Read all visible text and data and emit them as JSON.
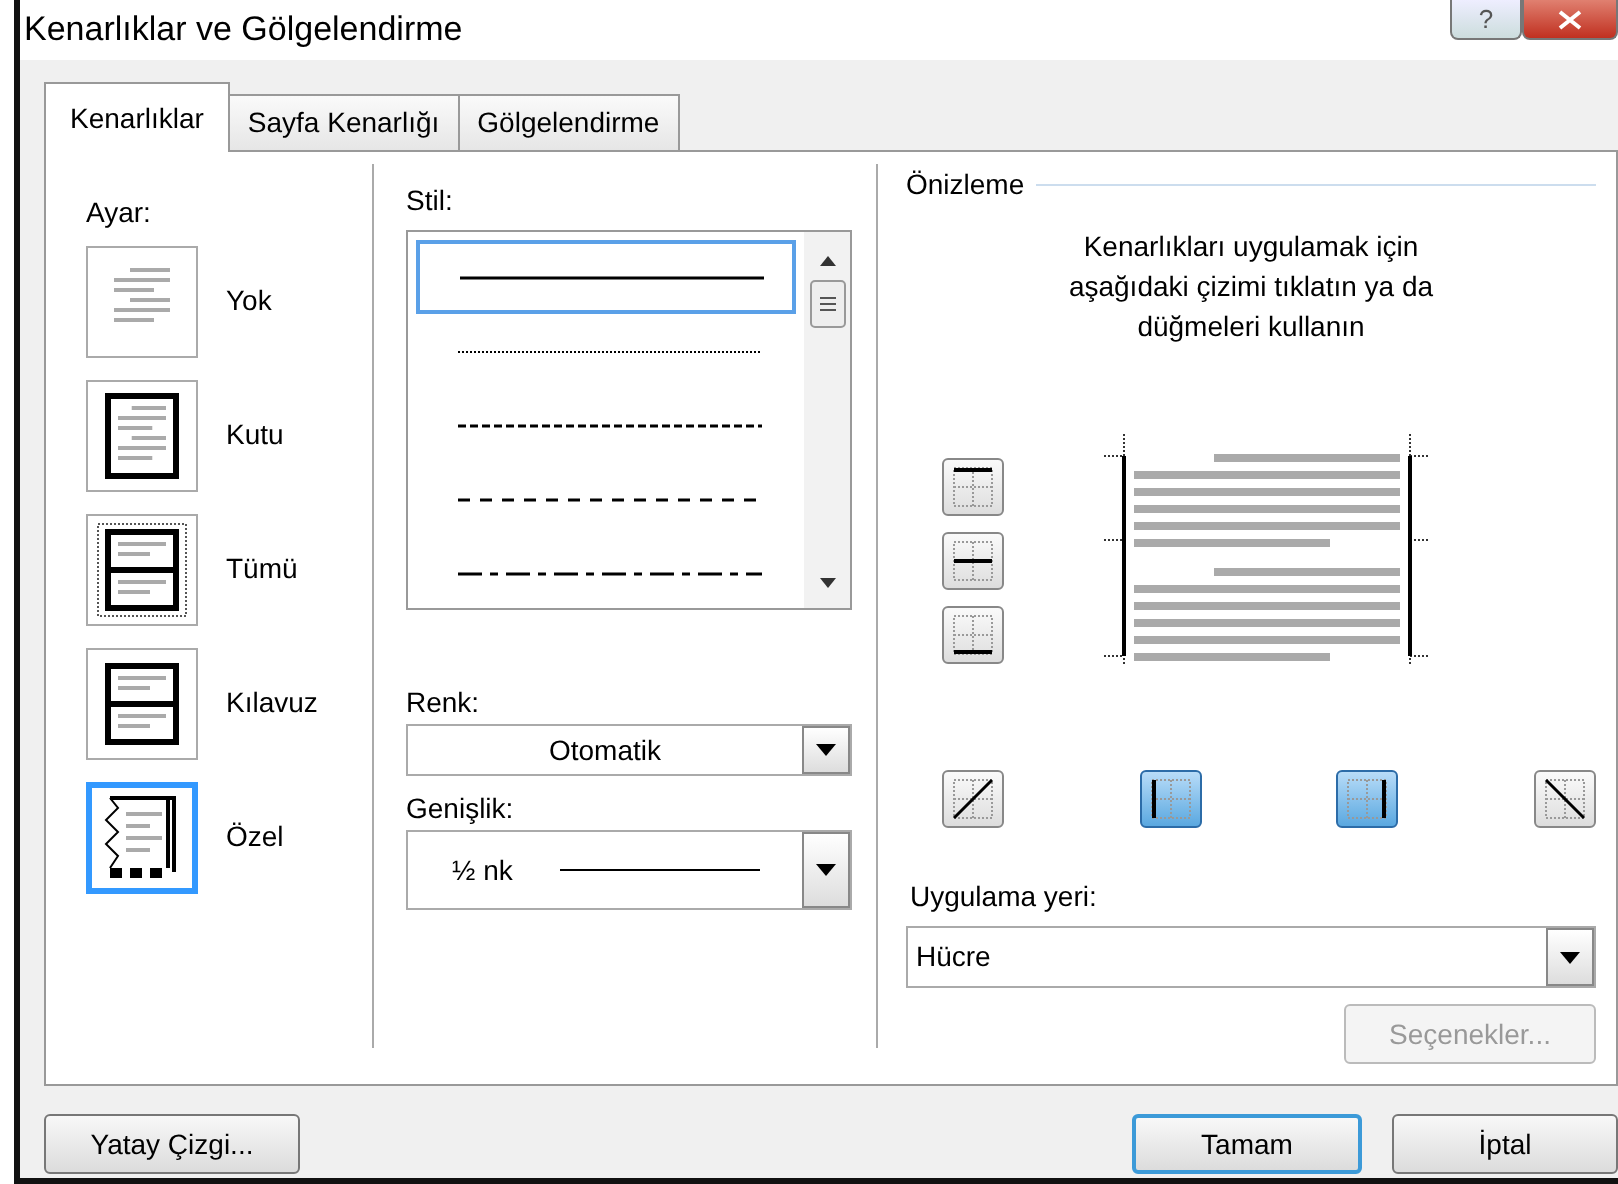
{
  "window": {
    "title": "Kenarlıklar ve Gölgelendirme"
  },
  "title_buttons": [
    {
      "kind": "help",
      "label": "?"
    },
    {
      "kind": "close"
    }
  ],
  "tabs": [
    {
      "label": "Kenarlıklar",
      "selected": true
    },
    {
      "label": "Sayfa Kenarlığı",
      "selected": false
    },
    {
      "label": "Gölgelendirme",
      "selected": false
    }
  ],
  "setting": {
    "label": "Ayar:",
    "items": [
      {
        "kind": "none",
        "label": "Yok",
        "selected": false
      },
      {
        "kind": "box",
        "label": "Kutu",
        "selected": false
      },
      {
        "kind": "all",
        "label": "Tümü",
        "selected": false
      },
      {
        "kind": "grid",
        "label": "Kılavuz",
        "selected": false
      },
      {
        "kind": "custom",
        "label": "Özel",
        "selected": true
      }
    ]
  },
  "style": {
    "label": "Stil:",
    "items": [
      {
        "kind": "solid",
        "selected": true
      },
      {
        "kind": "dotted",
        "selected": false
      },
      {
        "kind": "dashed",
        "selected": false
      },
      {
        "kind": "long-dash",
        "selected": false
      },
      {
        "kind": "dash-dot",
        "selected": false
      }
    ]
  },
  "color": {
    "label": "Renk:",
    "value": "Otomatik"
  },
  "width": {
    "label": "Genişlik:",
    "value": "½ nk"
  },
  "preview": {
    "title": "Önizleme",
    "instructions": "Kenarlıkları uygulamak için aşağıdaki çizimi tıklatın ya da düğmeleri kullanın",
    "side_buttons": [
      {
        "kind": "top",
        "on": false
      },
      {
        "kind": "middle",
        "on": false
      },
      {
        "kind": "bottom",
        "on": false
      }
    ],
    "bottom_buttons": [
      {
        "kind": "diagonal-up",
        "on": false
      },
      {
        "kind": "left",
        "on": true
      },
      {
        "kind": "right",
        "on": true
      },
      {
        "kind": "diagonal-down",
        "on": false
      }
    ]
  },
  "apply_to": {
    "label": "Uygulama yeri:",
    "value": "Hücre"
  },
  "options_button": {
    "label": "Seçenekler...",
    "disabled": true
  },
  "footer": {
    "horizontal_line": {
      "label": "Yatay Çizgi..."
    },
    "ok": {
      "label": "Tamam",
      "default": true
    },
    "cancel": {
      "label": "İptal"
    }
  }
}
